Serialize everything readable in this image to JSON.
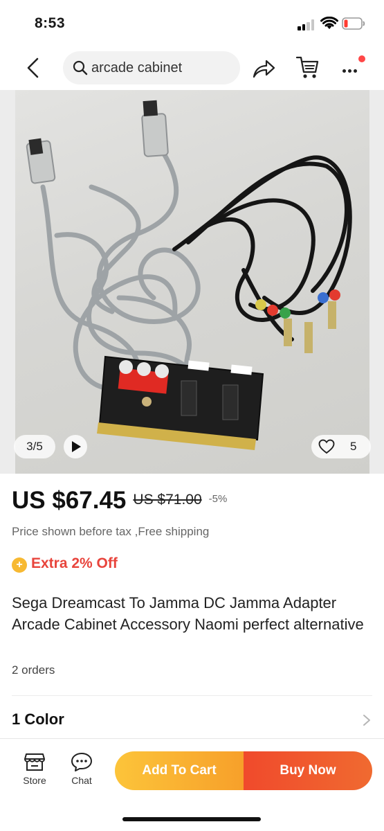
{
  "status_bar": {
    "time": "8:53"
  },
  "search": {
    "query": "arcade cabinet"
  },
  "gallery": {
    "counter": "3/5",
    "wish_count": "5"
  },
  "product": {
    "price": "US $67.45",
    "original_price": "US $71.00",
    "discount": "-5%",
    "tax_note": "Price shown before tax ,Free shipping",
    "coupon": "Extra 2% Off",
    "title": "Sega Dreamcast To Jamma DC Jamma Adapter Arcade Cabinet Accessory Naomi perfect alternative",
    "orders": "2 orders",
    "color_label": "1 Color"
  },
  "bottom_bar": {
    "store_label": "Store",
    "chat_label": "Chat",
    "add_to_cart_label": "Add To Cart",
    "buy_now_label": "Buy Now"
  },
  "colors": {
    "accent_orange": "#f7a02a",
    "accent_red": "#f04a2c",
    "coupon_red": "#e8443c",
    "coupon_gold": "#f7b932"
  },
  "icons": [
    "back-icon",
    "search-icon",
    "share-icon",
    "cart-icon",
    "more-icon",
    "play-icon",
    "heart-icon",
    "store-icon",
    "chat-icon",
    "chevron-right-icon"
  ]
}
